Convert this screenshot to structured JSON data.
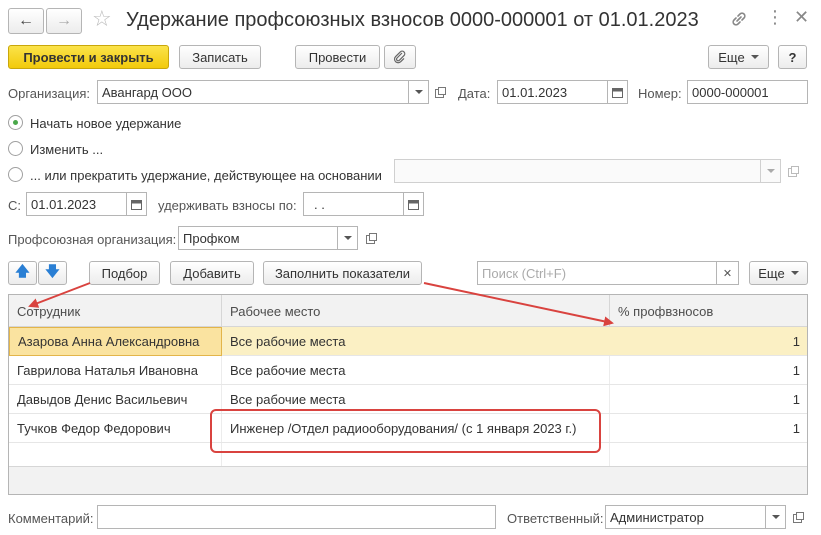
{
  "window": {
    "title": "Удержание профсоюзных взносов 0000-000001 от 01.01.2023"
  },
  "toolbar": {
    "post_close_label": "Провести и закрыть",
    "save_label": "Записать",
    "post_label": "Провести",
    "more_label": "Еще",
    "help_label": "?"
  },
  "header": {
    "org_label": "Организация:",
    "org_value": "Авангард ООО",
    "date_label": "Дата:",
    "date_value": "01.01.2023",
    "number_label": "Номер:",
    "number_value": "0000-000001"
  },
  "mode": {
    "options": [
      {
        "label": "Начать новое удержание",
        "checked": true
      },
      {
        "label": "Изменить ...",
        "checked": false
      },
      {
        "label": "... или прекратить удержание, действующее на основании",
        "checked": false
      }
    ],
    "basis_value": ""
  },
  "period": {
    "from_label": "С:",
    "from_value": "01.01.2023",
    "to_label": "удерживать взносы по:",
    "to_value": " .  ."
  },
  "union": {
    "label": "Профсоюзная организация:",
    "value": "Профком"
  },
  "table_toolbar": {
    "pick_label": "Подбор",
    "add_label": "Добавить",
    "fill_label": "Заполнить показатели",
    "search_placeholder": "Поиск (Ctrl+F)",
    "more_label": "Еще"
  },
  "table": {
    "columns": [
      "Сотрудник",
      "Рабочее место",
      "% профвзносов"
    ],
    "rows": [
      {
        "employee": "Азарова Анна Александровна",
        "workplace": "Все рабочие места",
        "percent": "1"
      },
      {
        "employee": "Гаврилова Наталья Ивановна",
        "workplace": "Все рабочие места",
        "percent": "1"
      },
      {
        "employee": "Давыдов Денис Васильевич",
        "workplace": "Все рабочие места",
        "percent": "1"
      },
      {
        "employee": "Тучков Федор Федорович",
        "workplace": "Инженер /Отдел радиооборудования/ (с 1 января 2023 г.)",
        "percent": "1"
      }
    ]
  },
  "footer": {
    "comment_label": "Комментарий:",
    "comment_value": "",
    "responsible_label": "Ответственный:",
    "responsible_value": "Администратор"
  },
  "colors": {
    "primary_button": "#f2ca0b",
    "selected_row": "#fbf0c4",
    "annotation": "#d9433f",
    "radio_checked": "#4aa84a"
  }
}
